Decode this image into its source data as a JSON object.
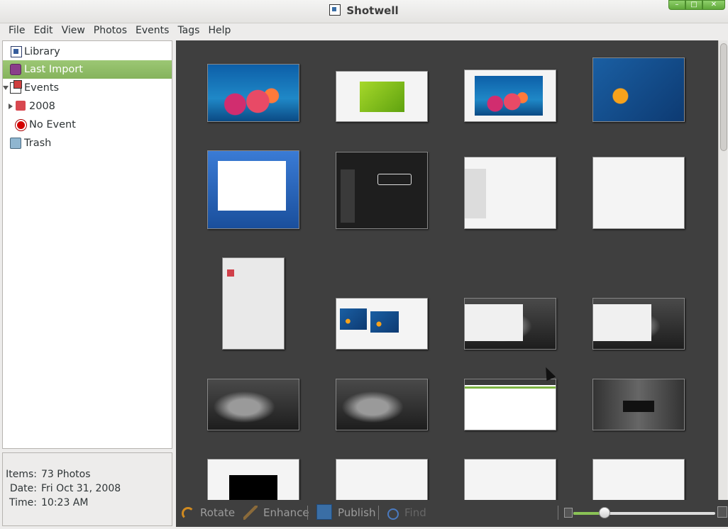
{
  "window": {
    "title": "Shotwell"
  },
  "menu": [
    "File",
    "Edit",
    "View",
    "Photos",
    "Events",
    "Tags",
    "Help"
  ],
  "sidebar": {
    "items": [
      {
        "label": "Library",
        "icon": "library-icon"
      },
      {
        "label": "Last Import",
        "icon": "last-import-icon",
        "selected": true
      },
      {
        "label": "Events",
        "icon": "events-icon",
        "expanded": true
      },
      {
        "label": "2008",
        "icon": "folder-icon",
        "expanded": false
      },
      {
        "label": "No Event",
        "icon": "no-event-icon"
      },
      {
        "label": "Trash",
        "icon": "trash-icon"
      }
    ]
  },
  "info": {
    "items_label": "Items:",
    "items_value": "73 Photos",
    "date_label": "Date:",
    "date_value": "Fri Oct 31, 2008",
    "time_label": "Time:",
    "time_value": "10:23 AM"
  },
  "thumbnails": [
    "coral-reef",
    "inkscape-window",
    "gimp-window",
    "gimp-blankon-splash",
    "vmware-windows-installer",
    "blankon-about-dialog",
    "synaptic-package-manager",
    "software-sources-dialog",
    "folder-properties-dialog",
    "browser-blankon",
    "desktop-file-browser",
    "desktop-file-browser-2",
    "dark-desktop",
    "dark-desktop-2",
    "web-page-white",
    "dark-login-screen",
    "black-window",
    "windows-dialog",
    "windows-dialog-2",
    "windows-dialog-3"
  ],
  "toolbar": {
    "rotate": "Rotate",
    "enhance": "Enhance",
    "publish": "Publish",
    "find": "Find",
    "zoom_level": 0.22
  },
  "colors": {
    "accent": "#85b35c",
    "viewer_bg": "#3f3f3f"
  }
}
